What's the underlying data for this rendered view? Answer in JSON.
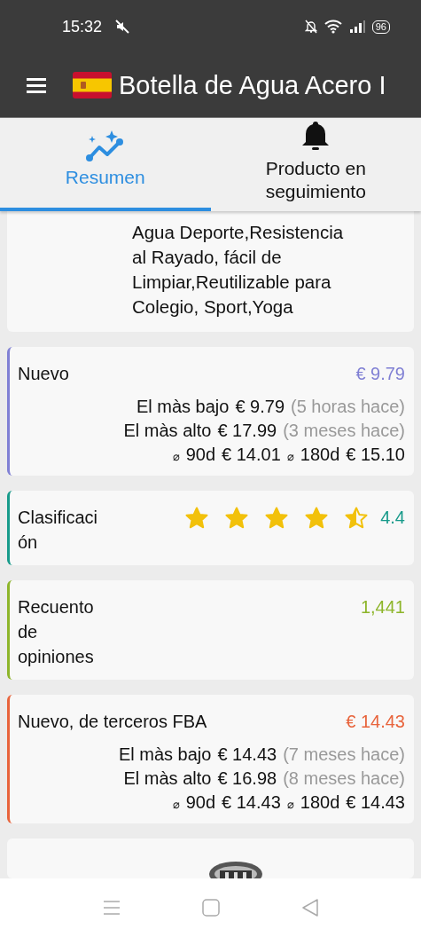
{
  "status_bar": {
    "time": "15:32",
    "battery": "96"
  },
  "app_bar": {
    "title": "Botella de Agua Acero I"
  },
  "tabs": [
    {
      "label": "Resumen",
      "selected": true,
      "kind": "chart"
    },
    {
      "label": "Producto en seguimiento",
      "selected": false,
      "kind": "bell"
    }
  ],
  "description_lines": [
    "Agua Deporte,Resistencia",
    "al Rayado, fácil de",
    "Limpiar,Reutilizable para",
    "Colegio, Sport,Yoga"
  ],
  "cards": [
    {
      "kind": "price",
      "title": "Nuevo",
      "value": "€ 9.79",
      "color": "#8080d4",
      "rows": [
        {
          "label": "El màs bajo",
          "price": "€ 9.79",
          "when": "(5 horas hace)"
        },
        {
          "label": "El màs alto",
          "price": "€ 17.99",
          "when": "(3 meses hace)"
        }
      ],
      "averages": [
        {
          "symbol": "⌀",
          "period": "90d",
          "price": "€ 14.01"
        },
        {
          "symbol": "⌀",
          "period": "180d",
          "price": "€ 15.10"
        }
      ]
    },
    {
      "kind": "rating",
      "title": "Clasificación",
      "value": "4.4",
      "color": "#179a8a",
      "stars": 4.5
    },
    {
      "kind": "count",
      "title": "Recuento de opiniones",
      "value": "1,441",
      "color": "#8db52a"
    },
    {
      "kind": "price",
      "title": "Nuevo, de terceros FBA",
      "value": "€ 14.43",
      "color": "#e8643c",
      "rows": [
        {
          "label": "El màs bajo",
          "price": "€ 14.43",
          "when": "(7 meses hace)"
        },
        {
          "label": "El màs alto",
          "price": "€ 16.98",
          "when": "(8 meses hace)"
        }
      ],
      "averages": [
        {
          "symbol": "⌀",
          "period": "90d",
          "price": "€ 14.43"
        },
        {
          "symbol": "⌀",
          "period": "180d",
          "price": "€ 14.43"
        }
      ]
    },
    {
      "kind": "picture"
    }
  ]
}
